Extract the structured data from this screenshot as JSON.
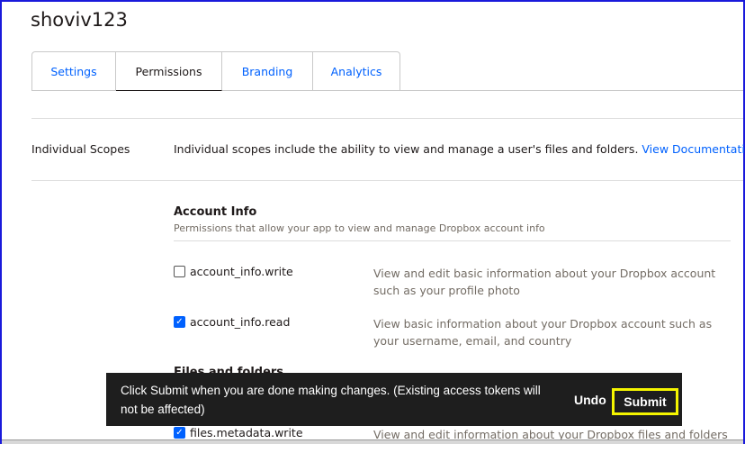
{
  "app_title": "shoviv123",
  "tabs": [
    {
      "label": "Settings"
    },
    {
      "label": "Permissions"
    },
    {
      "label": "Branding"
    },
    {
      "label": "Analytics"
    }
  ],
  "individual_scopes": {
    "label": "Individual Scopes",
    "description": "Individual scopes include the ability to view and manage a user's files and folders.",
    "link": "View Documentation"
  },
  "sections": [
    {
      "title": "Account Info",
      "subtitle": "Permissions that allow your app to view and manage Dropbox account info",
      "scopes": [
        {
          "name": "account_info.write",
          "checked": false,
          "description": "View and edit basic information about your Dropbox account such as your profile photo"
        },
        {
          "name": "account_info.read",
          "checked": true,
          "description": "View basic information about your Dropbox account such as your username, email, and country"
        }
      ]
    },
    {
      "title": "Files and folders",
      "scopes": [
        {
          "name": "files.metadata.write",
          "checked": true,
          "description": "View and edit information about your Dropbox files and folders"
        }
      ]
    }
  ],
  "toast": {
    "message": "Click Submit when you are done making changes. (Existing access tokens will not be affected)",
    "undo": "Undo",
    "submit": "Submit"
  },
  "colors": {
    "accent": "#0061fe",
    "highlight": "#f5f500"
  }
}
